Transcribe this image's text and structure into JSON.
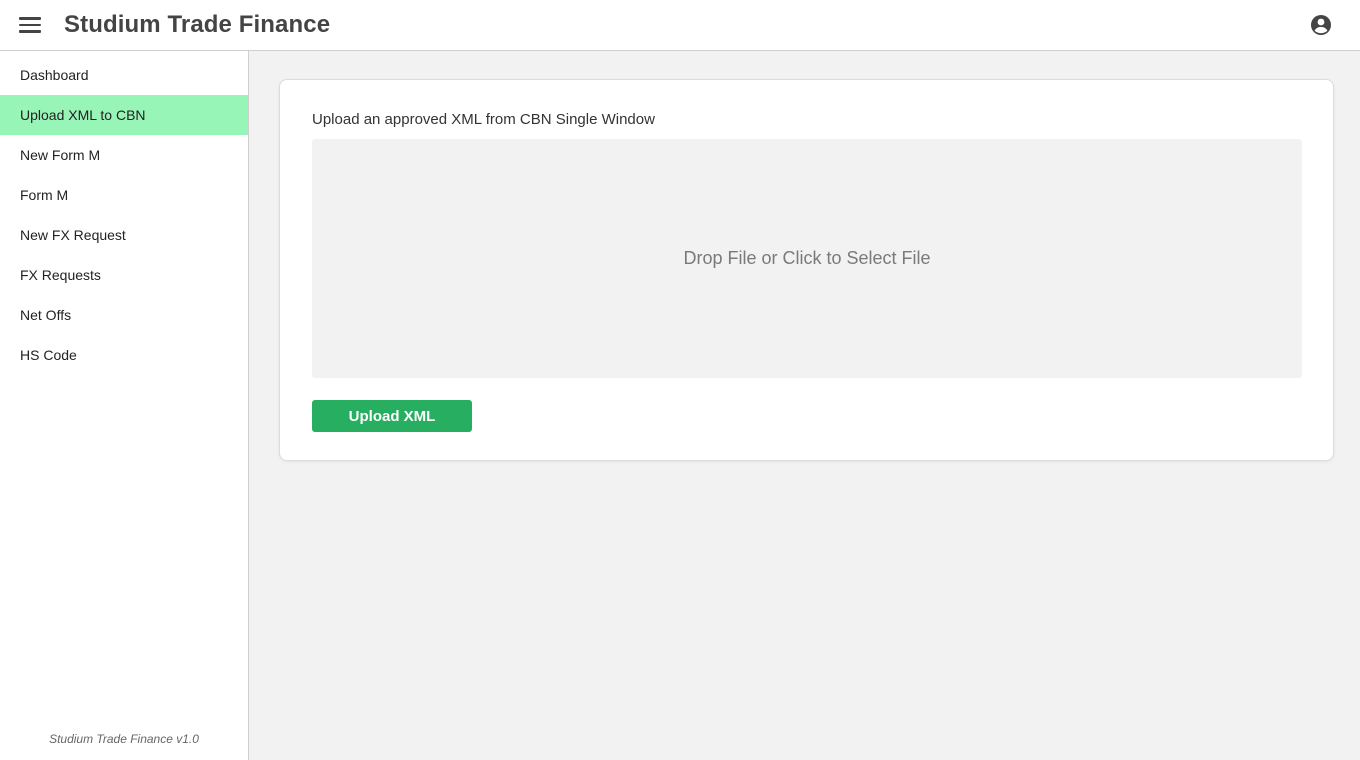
{
  "appbar": {
    "title": "Studium Trade Finance",
    "menu_icon": "hamburger-menu-icon",
    "account_icon": "account-circle-icon"
  },
  "sidebar": {
    "items": [
      {
        "label": "Dashboard",
        "active": false
      },
      {
        "label": "Upload XML to CBN",
        "active": true
      },
      {
        "label": "New Form M",
        "active": false
      },
      {
        "label": "Form M",
        "active": false
      },
      {
        "label": "New FX Request",
        "active": false
      },
      {
        "label": "FX Requests",
        "active": false
      },
      {
        "label": "Net Offs",
        "active": false
      },
      {
        "label": "HS Code",
        "active": false
      }
    ],
    "version": "Studium Trade Finance v1.0"
  },
  "upload_card": {
    "label": "Upload an approved XML from CBN Single Window",
    "dropzone_text": "Drop File or Click to Select File",
    "button_label": "Upload XML"
  },
  "colors": {
    "active_nav_bg": "#98f5b8",
    "primary_button": "#27ae60",
    "page_bg": "#f2f2f2"
  }
}
